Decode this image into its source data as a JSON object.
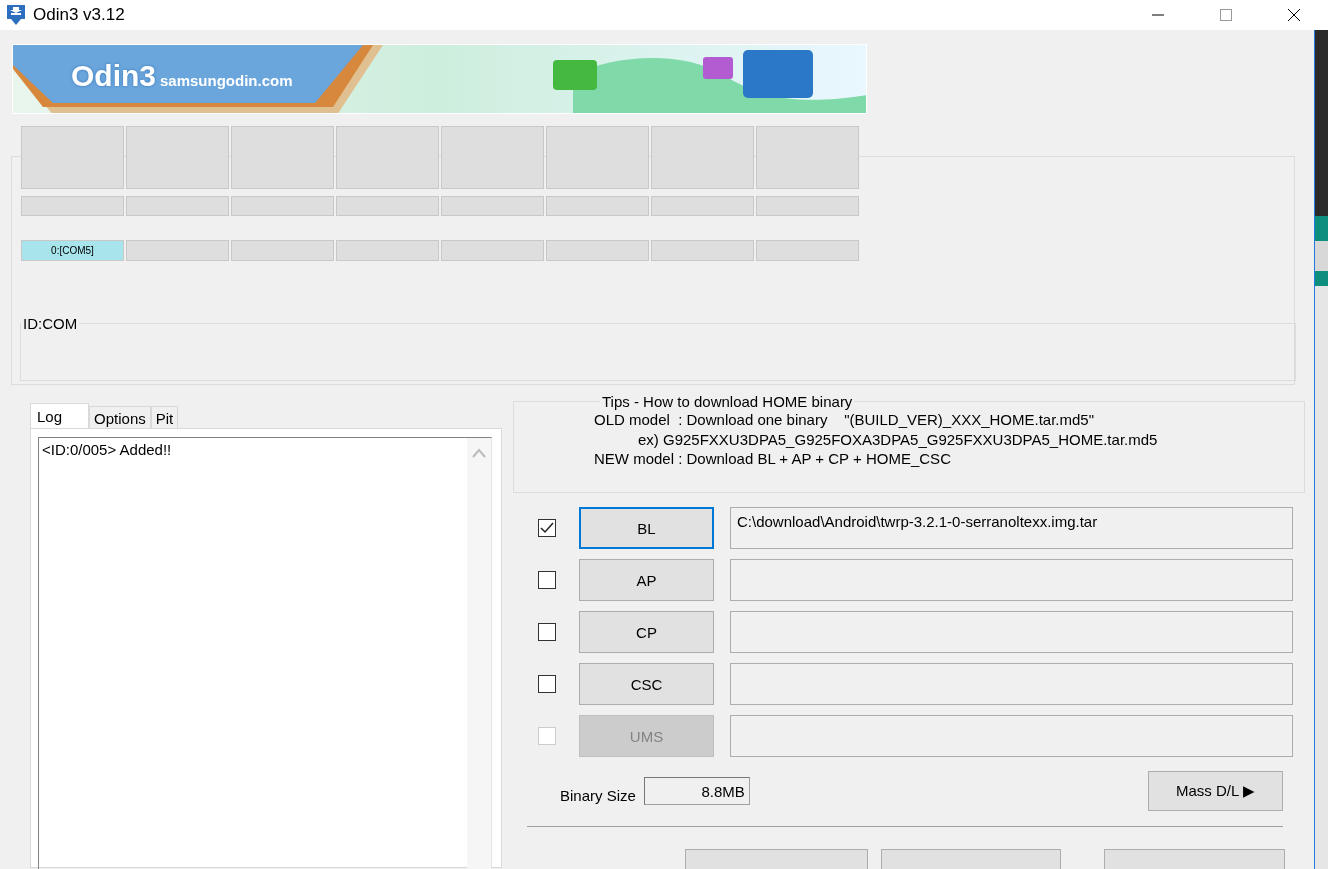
{
  "window": {
    "title": "Odin3 v3.12"
  },
  "banner": {
    "logo": "Odin3",
    "site": "samsungodin.com"
  },
  "ports": [
    {
      "label": "0:[COM5]",
      "connected": true,
      "level": 0
    },
    {
      "connected": false,
      "level": 0
    },
    {
      "connected": false,
      "level": 0
    },
    {
      "connected": false,
      "level": 0
    },
    {
      "connected": false,
      "level": 0
    },
    {
      "connected": false,
      "level": 0
    },
    {
      "connected": false,
      "level": 0
    },
    {
      "connected": false,
      "level": 0
    }
  ],
  "id_com": {
    "title": "ID:COM"
  },
  "tabs": [
    {
      "label": "Log",
      "selected": true
    },
    {
      "label": "Options",
      "selected": false
    },
    {
      "label": "Pit",
      "selected": false
    }
  ],
  "log": {
    "lines": [
      "<ID:0/005> Added!!"
    ]
  },
  "tips": {
    "title": "Tips - How to download HOME binary",
    "lines": [
      {
        "kind": "main",
        "text": "OLD model  : Download one binary    \"(BUILD_VER)_XXX_HOME.tar.md5\""
      },
      {
        "kind": "example",
        "text": "ex) G925FXXU3DPA5_G925FOXA3DPA5_G925FXXU3DPA5_HOME.tar.md5"
      },
      {
        "kind": "main",
        "text": "NEW model : Download BL + AP + CP + HOME_CSC"
      }
    ]
  },
  "files": [
    {
      "label": "BL",
      "checked": true,
      "disabled": false,
      "focused": true,
      "path": "C:\\download\\Android\\twrp-3.2.1-0-serranoltexx.img.tar"
    },
    {
      "label": "AP",
      "checked": false,
      "disabled": false,
      "focused": false
    },
    {
      "label": "CP",
      "checked": false,
      "disabled": false,
      "focused": false
    },
    {
      "label": "CSC",
      "checked": false,
      "disabled": false,
      "focused": false
    },
    {
      "label": "UMS",
      "checked": false,
      "disabled": true,
      "focused": false
    }
  ],
  "binary_size": {
    "label": "Binary Size",
    "value": "8.8MB"
  },
  "mass_dl": {
    "label": "Mass D/L ▶"
  }
}
